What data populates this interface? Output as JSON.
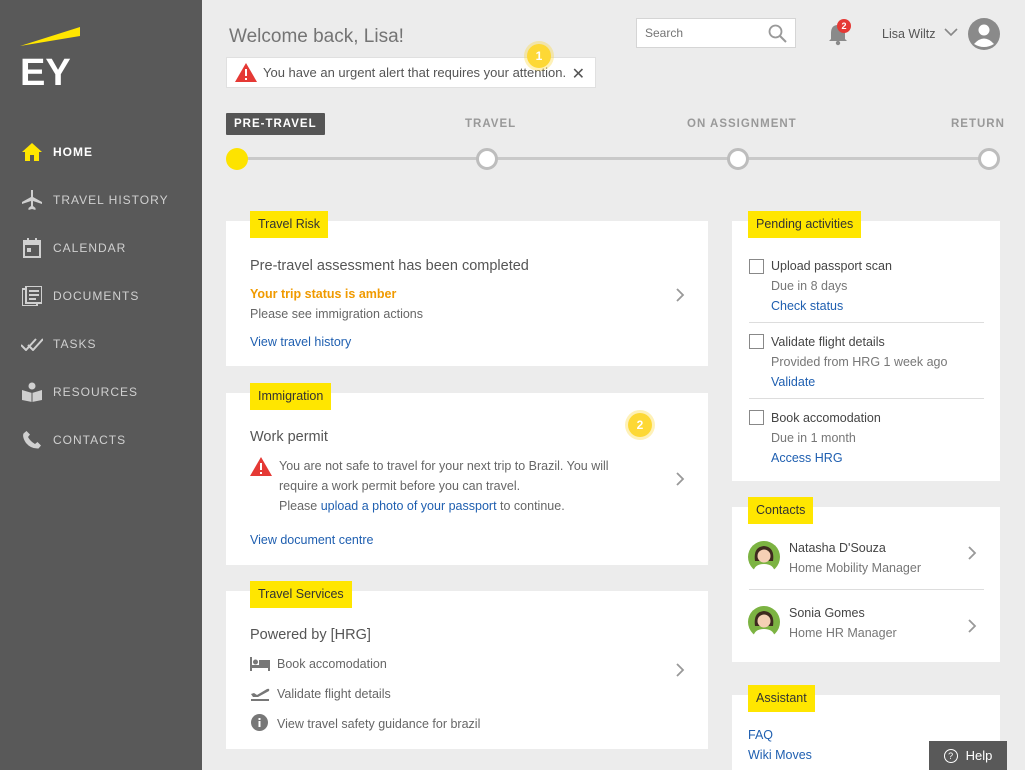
{
  "header": {
    "welcome": "Welcome back, Lisa!",
    "alert_text": "You have an urgent alert that requires your attention.",
    "alert_close": "✕",
    "marker_1": "1",
    "marker_2": "2",
    "search_placeholder": "Search",
    "notification_count": "2",
    "user_name": "Lisa Wiltz"
  },
  "sidebar": {
    "logo_text": "EY",
    "items": [
      {
        "label": "HOME",
        "icon": "home-icon",
        "active": true
      },
      {
        "label": "TRAVEL HISTORY",
        "icon": "airplane-icon"
      },
      {
        "label": "CALENDAR",
        "icon": "calendar-icon"
      },
      {
        "label": "DOCUMENTS",
        "icon": "documents-icon"
      },
      {
        "label": "TASKS",
        "icon": "tasks-icon"
      },
      {
        "label": "RESOURCES",
        "icon": "resources-icon"
      },
      {
        "label": "CONTACTS",
        "icon": "phone-icon"
      }
    ]
  },
  "stepper": {
    "steps": [
      "PRE-TRAVEL",
      "TRAVEL",
      "ON ASSIGNMENT",
      "RETURN"
    ],
    "current": "PRE-TRAVEL"
  },
  "travel_risk": {
    "tag": "Travel Risk",
    "title": "Pre-travel assessment has been completed",
    "status": "Your trip status is amber",
    "note": "Please see immigration actions",
    "link": "View travel history"
  },
  "immigration": {
    "tag": "Immigration",
    "title": "Work permit",
    "warning_line1": "You are not safe to travel for your next trip to Brazil. You will",
    "warning_line2": "require a work permit before you can travel.",
    "warning_line3_pre": "Please",
    "warning_line3_link": "upload a photo of your passport",
    "warning_line3_post": "to continue.",
    "link": "View document centre"
  },
  "travel_services": {
    "tag": "Travel Services",
    "title": "Powered by [HRG]",
    "items": [
      {
        "label": "Book accomodation",
        "icon": "bed-icon"
      },
      {
        "label": "Validate flight details",
        "icon": "flight-takeoff-icon"
      },
      {
        "label": "View travel safety guidance for brazil",
        "icon": "info-icon"
      }
    ]
  },
  "pending": {
    "tag": "Pending activities",
    "items": [
      {
        "title": "Upload passport scan",
        "sub": "Due in 8 days",
        "link": "Check status"
      },
      {
        "title": "Validate flight details",
        "sub": "Provided from HRG 1 week ago",
        "link": "Validate"
      },
      {
        "title": "Book accomodation",
        "sub": "Due in 1 month",
        "link": "Access HRG"
      }
    ]
  },
  "contacts": {
    "tag": "Contacts",
    "items": [
      {
        "name": "Natasha D'Souza",
        "role": "Home Mobility Manager"
      },
      {
        "name": "Sonia Gomes",
        "role": "Home HR Manager"
      }
    ]
  },
  "assistant": {
    "tag": "Assistant",
    "links": [
      "FAQ",
      "Wiki Moves"
    ]
  },
  "help": {
    "label": "Help"
  },
  "colors": {
    "accent": "#ffe600",
    "sidebar": "#595959",
    "amber": "#f09a00",
    "link": "#1f5fb0",
    "alert": "#e53935"
  }
}
